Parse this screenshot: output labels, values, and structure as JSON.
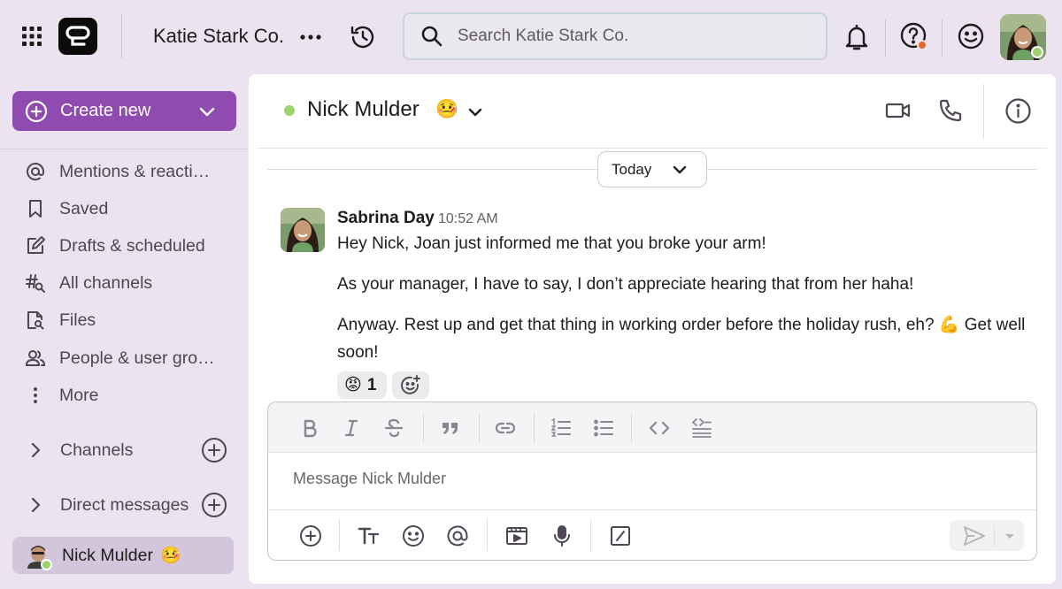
{
  "workspace": {
    "name": "Katie Stark Co."
  },
  "search": {
    "placeholder": "Search Katie Stark Co."
  },
  "sidebar": {
    "create_label": "Create new",
    "items": [
      {
        "label": "Mentions & reacti…",
        "icon": "at-icon"
      },
      {
        "label": "Saved",
        "icon": "bookmark-icon"
      },
      {
        "label": "Drafts & scheduled",
        "icon": "edit-icon"
      },
      {
        "label": "All channels",
        "icon": "channel-search-icon"
      },
      {
        "label": "Files",
        "icon": "file-search-icon"
      },
      {
        "label": "People & user gro…",
        "icon": "people-icon"
      },
      {
        "label": "More",
        "icon": "more-vertical-icon"
      }
    ],
    "sections": [
      {
        "label": "Channels"
      },
      {
        "label": "Direct messages"
      }
    ],
    "active_dm": {
      "name": "Nick Mulder",
      "status_emoji": "🤒"
    }
  },
  "channel": {
    "name": "Nick Mulder",
    "status_emoji": "🤒",
    "presence_color": "#9bd36f"
  },
  "day_divider": {
    "label": "Today"
  },
  "message": {
    "author": "Sabrina Day",
    "time": "10:52 AM",
    "lines": [
      "Hey Nick, Joan just informed me that you broke your arm!",
      "As your manager, I have to say, I don’t appreciate hearing that from her haha!",
      "Anyway. Rest up and get that thing in working order before the holiday rush, eh? 💪 Get well soon!"
    ],
    "reaction": {
      "emoji": "😡",
      "count": "1"
    }
  },
  "composer": {
    "placeholder": "Message Nick Mulder"
  },
  "colors": {
    "background": "#ece3f1",
    "accent": "#8f4bb0",
    "presence": "#9bd36f",
    "notification_dot": "#e8632b"
  }
}
